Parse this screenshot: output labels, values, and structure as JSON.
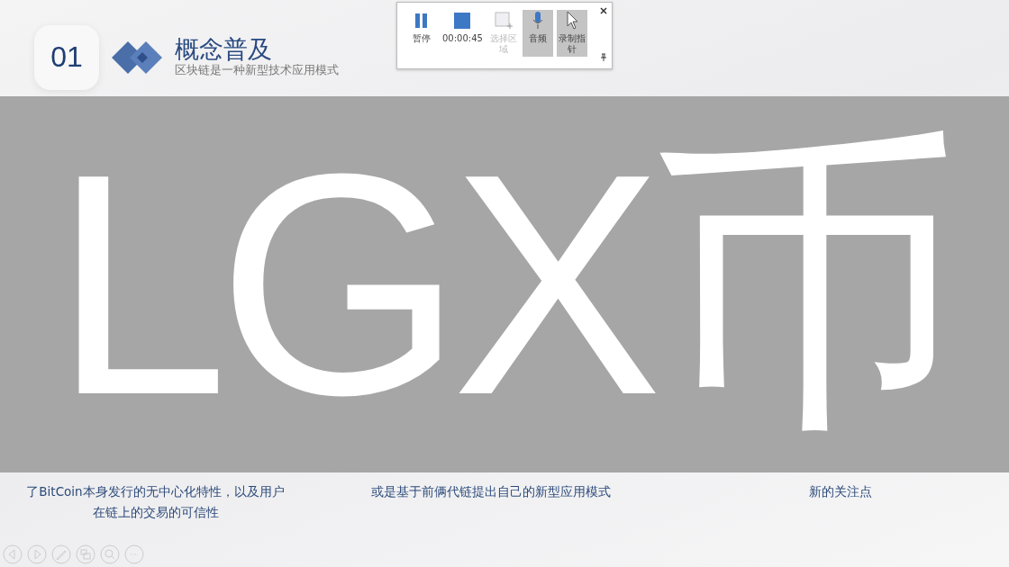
{
  "header": {
    "number": "01",
    "title": "概念普及",
    "subtitle": "区块链是一种新型技术应用模式"
  },
  "recording_toolbar": {
    "buttons": [
      {
        "kind": "pause",
        "label": "暂停",
        "disabled": false,
        "on": false
      },
      {
        "kind": "stop",
        "label": "00:00:45",
        "disabled": false,
        "on": false
      },
      {
        "kind": "region",
        "label": "选择区域",
        "disabled": true,
        "on": false
      },
      {
        "kind": "audio",
        "label": "音频",
        "disabled": false,
        "on": true
      },
      {
        "kind": "pointer",
        "label": "录制指针",
        "disabled": false,
        "on": true
      }
    ]
  },
  "overlay_banner": {
    "text": "LGX币"
  },
  "columns": [
    {
      "text": "了BitCoin本身发行的无中心化特性，以及用户在链上的交易的可信性"
    },
    {
      "text": "或是基于前俩代链提出自己的新型应用模式"
    },
    {
      "text": "新的关注点"
    }
  ]
}
